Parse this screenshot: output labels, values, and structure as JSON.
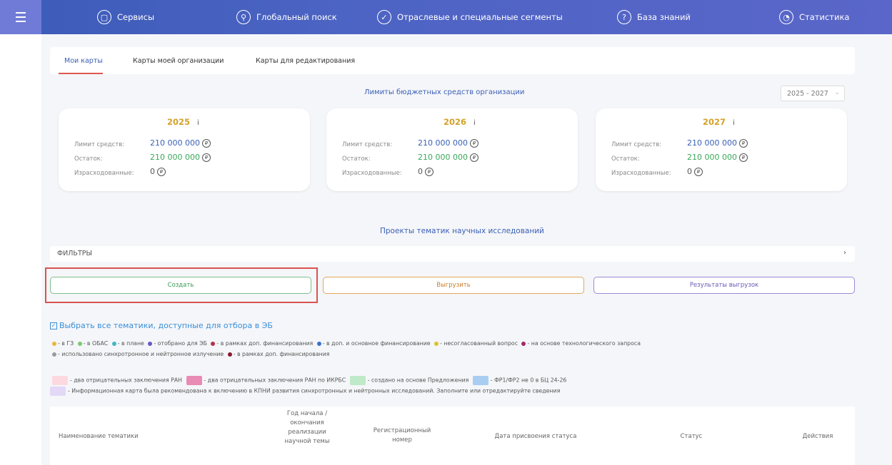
{
  "nav": {
    "items": [
      {
        "label": "Сервисы",
        "icon": "services-icon"
      },
      {
        "label": "Глобальный поиск",
        "icon": "search-icon"
      },
      {
        "label": "Отраслевые и специальные сегменты",
        "icon": "check-circle-icon"
      },
      {
        "label": "База знаний",
        "icon": "question-icon"
      },
      {
        "label": "Статистика",
        "icon": "stats-icon"
      }
    ]
  },
  "tabs": [
    "Мои карты",
    "Карты моей организации",
    "Карты для редактирования"
  ],
  "limits": {
    "title": "Лимиты бюджетных средств организации",
    "period": "2025 - 2027",
    "labels": {
      "limit": "Лимит средств:",
      "rest": "Остаток:",
      "spent": "Израсходованные:"
    },
    "info": "i",
    "rub": "₽",
    "cards": [
      {
        "year": "2025",
        "limit": "210 000 000",
        "rest": "210 000 000",
        "spent": "0"
      },
      {
        "year": "2026",
        "limit": "210 000 000",
        "rest": "210 000 000",
        "spent": "0"
      },
      {
        "year": "2027",
        "limit": "210 000 000",
        "rest": "210 000 000",
        "spent": "0"
      }
    ]
  },
  "projects": {
    "title": "Проекты тематик научных исследований",
    "filters": "ФИЛЬТРЫ",
    "buttons": {
      "create": "Создать",
      "export": "Выгрузить",
      "results": "Результаты выгрузок"
    },
    "select_all": "Выбрать все тематики, доступные для отбора в ЭБ",
    "legend_dots": [
      {
        "color": "#e8b83a",
        "text": "- в ГЗ"
      },
      {
        "color": "#7bc96f",
        "text": "- в ОБАС"
      },
      {
        "color": "#3fb6c4",
        "text": "- в плане"
      },
      {
        "color": "#6a56c8",
        "text": "- отобрано для ЭБ"
      },
      {
        "color": "#b5324a",
        "text": "- в рамках доп. финансирования"
      },
      {
        "color": "#3a6fd0",
        "text": "- в доп. и основное финансирование"
      },
      {
        "color": "#d9c42a",
        "text": "- несогласованный вопрос"
      },
      {
        "color": "#a0296a",
        "text": "- на основе технологического запроса"
      },
      {
        "color": "#9a9a9a",
        "text": "- использовано синхротронное и нейтронное излучение"
      },
      {
        "color": "#8a1a2e",
        "text": "- в рамках доп. финансирования"
      }
    ],
    "legend_squares": [
      {
        "color": "#fcd9e0",
        "text": "- два отрицательных заключения РАН"
      },
      {
        "color": "#e88bb5",
        "text": "- два отрицательных заключения РАН по ИКРБС"
      },
      {
        "color": "#bfe9c8",
        "text": "- создано на основе Предложения"
      },
      {
        "color": "#a9cdf0",
        "text": "- ФР1/ФР2 не 0 в БЦ 24-26"
      },
      {
        "color": "#e3d8f6",
        "text": "- Информационная карта была рекомендована к включению в КПНИ развития синхротронных и нейтронных исследований. Заполните или отредактируйте сведения"
      }
    ]
  },
  "table": {
    "columns": [
      "Наименование тематики",
      "Год начала / окончания реализации научной темы",
      "Регистрационный номер",
      "Дата присвоения статуса",
      "Статус",
      "Действия"
    ]
  }
}
